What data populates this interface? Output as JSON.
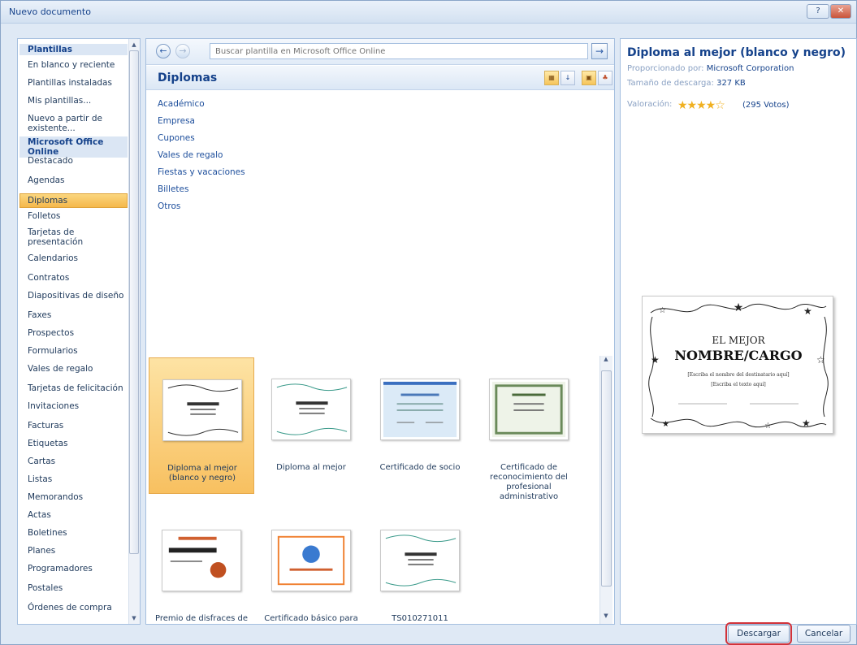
{
  "window": {
    "title": "Nuevo documento",
    "help": "?",
    "close": "✕"
  },
  "sidebar": {
    "items": [
      {
        "label": "Plantillas",
        "type": "section"
      },
      {
        "label": "En blanco y reciente"
      },
      {
        "label": "Plantillas instaladas"
      },
      {
        "label": "Mis plantillas..."
      },
      {
        "label": "Nuevo a partir de existente..."
      },
      {
        "label": "Microsoft Office Online",
        "type": "section"
      },
      {
        "label": "Destacado"
      },
      {
        "label": "Agendas"
      },
      {
        "label": "Diplomas",
        "type": "selected"
      },
      {
        "label": "Folletos"
      },
      {
        "label": "Tarjetas de presentación"
      },
      {
        "label": "Calendarios"
      },
      {
        "label": "Contratos"
      },
      {
        "label": "Diapositivas de diseño"
      },
      {
        "label": "Faxes"
      },
      {
        "label": "Prospectos"
      },
      {
        "label": "Formularios"
      },
      {
        "label": "Vales de regalo"
      },
      {
        "label": "Tarjetas de felicitación"
      },
      {
        "label": "Invitaciones"
      },
      {
        "label": "Facturas"
      },
      {
        "label": "Etiquetas"
      },
      {
        "label": "Cartas"
      },
      {
        "label": "Listas"
      },
      {
        "label": "Memorandos"
      },
      {
        "label": "Actas"
      },
      {
        "label": "Boletines"
      },
      {
        "label": "Planes"
      },
      {
        "label": "Programadores"
      },
      {
        "label": "Postales"
      },
      {
        "label": "Órdenes de compra"
      }
    ]
  },
  "search": {
    "placeholder": "Buscar plantilla en Microsoft Office Online",
    "back": "←",
    "forward": "→",
    "go": "→"
  },
  "center": {
    "title": "Diplomas",
    "categories": [
      "Académico",
      "Empresa",
      "Cupones",
      "Vales de regalo",
      "Fiestas y vacaciones",
      "Billetes",
      "Otros"
    ],
    "templates": [
      {
        "label": "Diploma al mejor (blanco y negro)",
        "selected": true
      },
      {
        "label": "Diploma al mejor"
      },
      {
        "label": "Certificado de socio"
      },
      {
        "label": "Certificado de reconocimiento del profesional administrativo"
      },
      {
        "label": "Premio de disfraces de"
      },
      {
        "label": "Certificado básico para"
      },
      {
        "label": "TS010271011"
      }
    ]
  },
  "details": {
    "title": "Diploma al mejor (blanco y negro)",
    "provider_label": "Proporcionado por:",
    "provider": "Microsoft Corporation",
    "size_label": "Tamaño de descarga:",
    "size": "327 KB",
    "rating_label": "Valoración:",
    "rating": 4,
    "rating_max": 5,
    "votes": "(295 Votos)",
    "preview": {
      "line1": "EL MEJOR",
      "line2": "NOMBRE/CARGO",
      "line3": "[Escriba el nombre del destinatario aquí]",
      "line4": "[Escriba el texto aquí]"
    }
  },
  "buttons": {
    "download": "Descargar",
    "cancel": "Cancelar"
  },
  "colors": {
    "accent": "#15428b",
    "selected": "#f8c060",
    "highlight": "#d1323a"
  }
}
